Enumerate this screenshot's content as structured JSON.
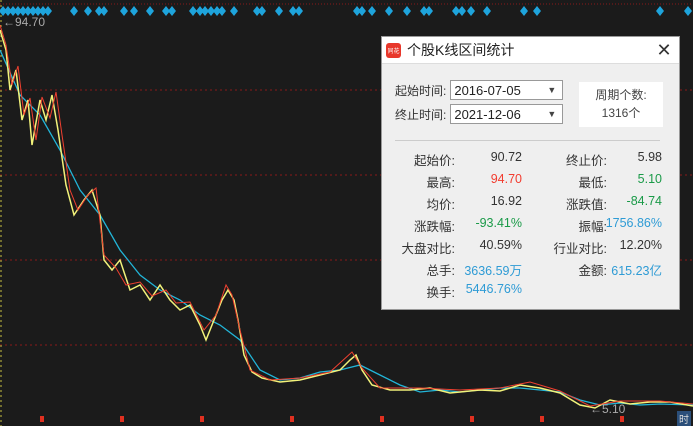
{
  "chart": {
    "max_label": "94.70",
    "min_label": "5.10",
    "corner_label": "时"
  },
  "dialog": {
    "title": "个股K线区间统计",
    "close": "✕",
    "logo": "同花",
    "start_label": "起始时间:",
    "start_value": "2016-07-05",
    "end_label": "终止时间:",
    "end_value": "2021-12-06",
    "period_label": "周期个数:",
    "period_value": "1316个",
    "stats": [
      {
        "label": "起始价:",
        "value": "90.72",
        "color": ""
      },
      {
        "label": "终止价:",
        "value": "5.98",
        "color": ""
      },
      {
        "label": "最高:",
        "value": "94.70",
        "color": "red"
      },
      {
        "label": "最低:",
        "value": "5.10",
        "color": "green"
      },
      {
        "label": "均价:",
        "value": "16.92",
        "color": ""
      },
      {
        "label": "涨跌值:",
        "value": "-84.74",
        "color": "green"
      },
      {
        "label": "涨跌幅:",
        "value": "-93.41%",
        "color": "green"
      },
      {
        "label": "振幅:",
        "value": "1756.86%",
        "color": "blue"
      },
      {
        "label": "大盘对比:",
        "value": "40.59%",
        "color": ""
      },
      {
        "label": "行业对比:",
        "value": "12.20%",
        "color": ""
      },
      {
        "label": "总手:",
        "value": "3636.59万",
        "color": "blue"
      },
      {
        "label": "金额:",
        "value": "615.23亿",
        "color": "blue"
      },
      {
        "label": "换手:",
        "value": "5446.76%",
        "color": "blue"
      }
    ]
  }
}
